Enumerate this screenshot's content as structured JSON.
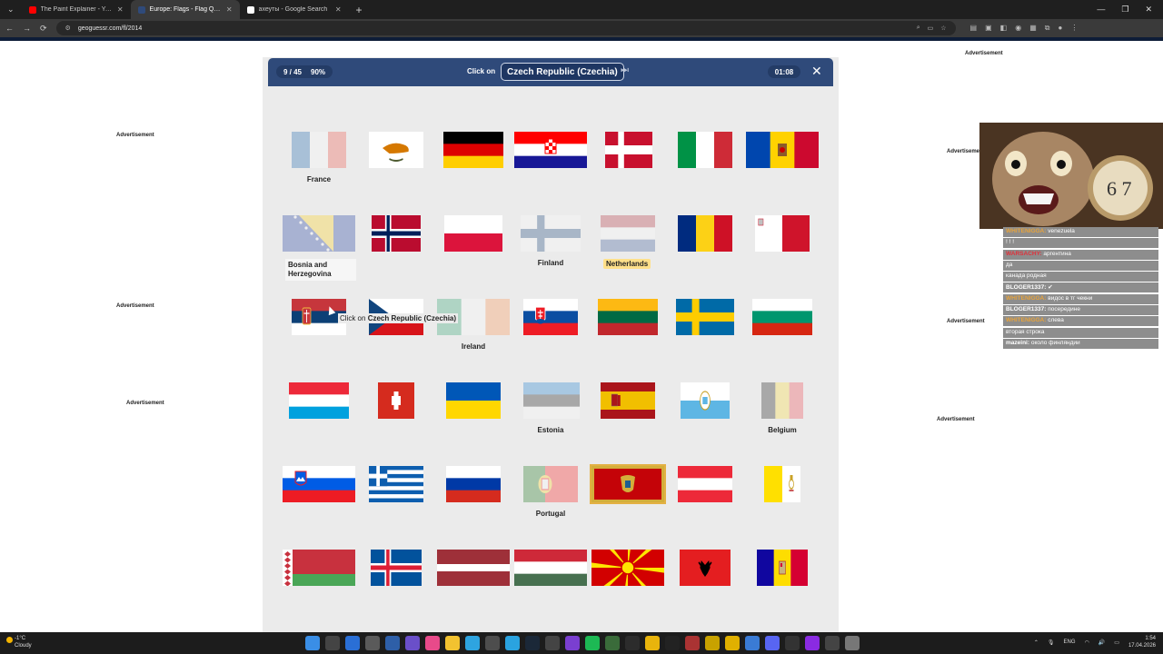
{
  "browser": {
    "tabs": [
      {
        "title": "The Paint Explainer - YouTube",
        "fav_color": "#ff0000",
        "active": false
      },
      {
        "title": "Europe: Flags - Flag Quiz Game",
        "fav_color": "#2f4a7a",
        "active": true
      },
      {
        "title": "ахеуты - Google Search",
        "fav_color": "#ffffff",
        "active": false
      }
    ],
    "new_tab": "+",
    "url": "geoguessr.com/fl/2014"
  },
  "ads": {
    "label": "Advertisement"
  },
  "game": {
    "progress": "9 / 45",
    "accuracy": "90%",
    "click_on": "Click on",
    "target": "Czech Republic (Czechia)",
    "timer": "01:08",
    "tooltip_prefix": "Click on",
    "tooltip_target": "Czech Republic (Czechia)",
    "flags": [
      {
        "id": "france",
        "state": "found",
        "label": "France"
      },
      {
        "id": "cyprus",
        "state": "open",
        "label": ""
      },
      {
        "id": "germany",
        "state": "open",
        "label": ""
      },
      {
        "id": "croatia",
        "state": "open",
        "label": ""
      },
      {
        "id": "denmark",
        "state": "open",
        "label": ""
      },
      {
        "id": "italy",
        "state": "open",
        "label": ""
      },
      {
        "id": "moldova",
        "state": "open",
        "label": ""
      },
      {
        "id": "bosnia",
        "state": "found",
        "label": "Bosnia and Herzegovina"
      },
      {
        "id": "norway",
        "state": "open",
        "label": ""
      },
      {
        "id": "poland",
        "state": "open",
        "label": ""
      },
      {
        "id": "finland",
        "state": "found",
        "label": "Finland"
      },
      {
        "id": "netherlands",
        "state": "found",
        "label": "Netherlands"
      },
      {
        "id": "romania",
        "state": "open",
        "label": ""
      },
      {
        "id": "malta",
        "state": "open",
        "label": ""
      },
      {
        "id": "serbia",
        "state": "open",
        "label": ""
      },
      {
        "id": "czechia",
        "state": "open",
        "label": ""
      },
      {
        "id": "ireland",
        "state": "found",
        "label": "Ireland"
      },
      {
        "id": "slovakia",
        "state": "open",
        "label": ""
      },
      {
        "id": "lithuania",
        "state": "open",
        "label": ""
      },
      {
        "id": "sweden",
        "state": "open",
        "label": ""
      },
      {
        "id": "bulgaria",
        "state": "open",
        "label": ""
      },
      {
        "id": "luxembourg",
        "state": "open",
        "label": ""
      },
      {
        "id": "switzerland",
        "state": "open",
        "label": ""
      },
      {
        "id": "ukraine",
        "state": "open",
        "label": ""
      },
      {
        "id": "estonia",
        "state": "found",
        "label": "Estonia"
      },
      {
        "id": "spain",
        "state": "open",
        "label": ""
      },
      {
        "id": "san-marino",
        "state": "open",
        "label": ""
      },
      {
        "id": "belgium",
        "state": "found",
        "label": "Belgium"
      },
      {
        "id": "slovenia",
        "state": "open",
        "label": ""
      },
      {
        "id": "greece",
        "state": "open",
        "label": ""
      },
      {
        "id": "russia",
        "state": "open",
        "label": ""
      },
      {
        "id": "portugal",
        "state": "found",
        "label": "Portugal"
      },
      {
        "id": "montenegro",
        "state": "open",
        "label": ""
      },
      {
        "id": "austria",
        "state": "open",
        "label": ""
      },
      {
        "id": "vatican",
        "state": "open",
        "label": ""
      },
      {
        "id": "belarus",
        "state": "open",
        "label": ""
      },
      {
        "id": "iceland",
        "state": "open",
        "label": ""
      },
      {
        "id": "latvia",
        "state": "open",
        "label": ""
      },
      {
        "id": "hungary",
        "state": "open",
        "label": ""
      },
      {
        "id": "north-macedonia",
        "state": "open",
        "label": ""
      },
      {
        "id": "albania",
        "state": "open",
        "label": ""
      },
      {
        "id": "andorra",
        "state": "open",
        "label": ""
      }
    ]
  },
  "chat": [
    {
      "user": "WHITENIGGA:",
      "user_color": "#e8a33a",
      "text": "venezuela"
    },
    {
      "user": "",
      "user_color": "#e8a33a",
      "text": "! ! !"
    },
    {
      "user": "WARSACHY:",
      "user_color": "#e0303a",
      "text": "аргентина"
    },
    {
      "user": "",
      "user_color": "#9b59b6",
      "text": "да"
    },
    {
      "user": "",
      "user_color": "#9b59b6",
      "text": "канада родная"
    },
    {
      "user": "BLOGER1337:",
      "user_color": "#ffffff",
      "text": "✔"
    },
    {
      "user": "WHITENIGGA:",
      "user_color": "#e8a33a",
      "text": "видос в тг чекни"
    },
    {
      "user": "BLOGER1337:",
      "user_color": "#ffffff",
      "text": "посередине"
    },
    {
      "user": "WHITENIGGA:",
      "user_color": "#e8a33a",
      "text": "слева"
    },
    {
      "user": "",
      "user_color": "#9b59b6",
      "text": "вторая строка"
    },
    {
      "user": "mazeini:",
      "user_color": "#ffffff",
      "text": "около финляндии"
    }
  ],
  "taskbar": {
    "temp": "-1°C",
    "condition": "Cloudy",
    "lang": "ENG",
    "time": "1:54",
    "date": "17.04.2026"
  }
}
